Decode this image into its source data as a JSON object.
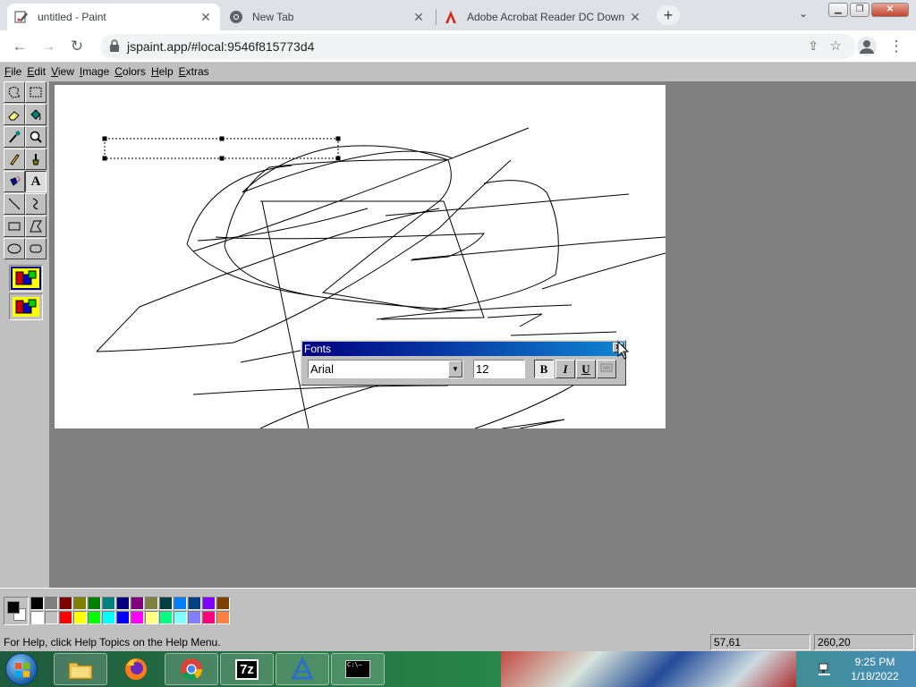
{
  "browser": {
    "tabs": [
      {
        "title": "untitled - Paint",
        "icon": "paint-icon",
        "active": true
      },
      {
        "title": "New Tab",
        "icon": "chrome-icon",
        "active": false
      },
      {
        "title": "Adobe Acrobat Reader DC Down",
        "icon": "acrobat-icon",
        "active": false
      }
    ],
    "url": "jspaint.app/#local:9546f815773d4"
  },
  "paint": {
    "menus": [
      {
        "key": "F",
        "rest": "ile"
      },
      {
        "key": "E",
        "rest": "dit"
      },
      {
        "key": "V",
        "rest": "iew"
      },
      {
        "key": "I",
        "rest": "mage"
      },
      {
        "key": "C",
        "rest": "olors"
      },
      {
        "key": "H",
        "rest": "elp"
      },
      {
        "key": "E",
        "rest": "xtras"
      }
    ],
    "tools": [
      "free-form-select",
      "select",
      "eraser",
      "fill-with-color",
      "pick-color",
      "magnifier",
      "pencil",
      "brush",
      "airbrush",
      "text",
      "line",
      "curve",
      "rectangle",
      "polygon",
      "ellipse",
      "rounded-rectangle"
    ],
    "active_tool": "text",
    "fonts_dialog": {
      "title": "Fonts",
      "font_name": "Arial",
      "font_size": "12",
      "bold_label": "B",
      "italic_label": "I",
      "underline_label": "U",
      "bold_on": true
    },
    "palette": {
      "foreground": "#000000",
      "background": "#ffffff",
      "colors_row1": [
        "#000000",
        "#808080",
        "#800000",
        "#808000",
        "#008000",
        "#008080",
        "#000080",
        "#800080",
        "#808040",
        "#004040",
        "#0080ff",
        "#004080",
        "#8000ff",
        "#804000"
      ],
      "colors_row2": [
        "#ffffff",
        "#c0c0c0",
        "#ff0000",
        "#ffff00",
        "#00ff00",
        "#00ffff",
        "#0000ff",
        "#ff00ff",
        "#ffff80",
        "#00ff80",
        "#80ffff",
        "#8080ff",
        "#ff0080",
        "#ff8040"
      ]
    },
    "status": {
      "help_text": "For Help, click Help Topics on the Help Menu.",
      "cursor_position": "57,61",
      "canvas_size": "260,20"
    }
  },
  "taskbar": {
    "apps": [
      "file-explorer",
      "firefox",
      "chrome",
      "7-zip",
      "app-launcher",
      "command-prompt"
    ],
    "app_labels": {
      "seven_zip": "7z",
      "cmd": "C:\\"
    },
    "time": "9:25 PM",
    "date": "1/18/2022"
  }
}
